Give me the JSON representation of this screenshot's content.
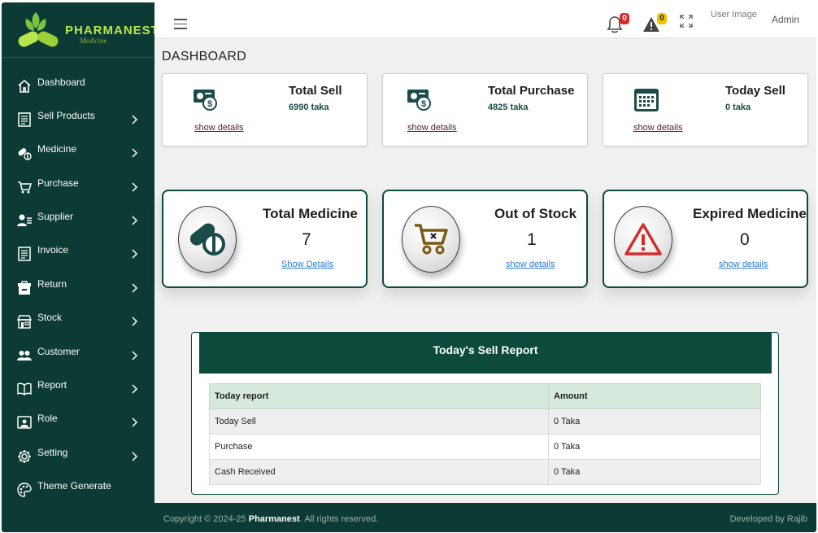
{
  "brand": {
    "name": "PHARMANEST",
    "tagline": "Medicine"
  },
  "sidebar": {
    "items": [
      {
        "label": "Dashboard",
        "icon": "home-icon",
        "has_children": false
      },
      {
        "label": "Sell Products",
        "icon": "receipt-icon",
        "has_children": true
      },
      {
        "label": "Medicine",
        "icon": "pill-icon",
        "has_children": true
      },
      {
        "label": "Purchase",
        "icon": "cart-icon",
        "has_children": true
      },
      {
        "label": "Supplier",
        "icon": "supplier-icon",
        "has_children": true
      },
      {
        "label": "Invoice",
        "icon": "invoice-icon",
        "has_children": true
      },
      {
        "label": "Return",
        "icon": "return-box-icon",
        "has_children": true
      },
      {
        "label": "Stock",
        "icon": "store-icon",
        "has_children": true
      },
      {
        "label": "Customer",
        "icon": "users-icon",
        "has_children": true
      },
      {
        "label": "Report",
        "icon": "book-icon",
        "has_children": true
      },
      {
        "label": "Role",
        "icon": "id-badge-icon",
        "has_children": true
      },
      {
        "label": "Setting",
        "icon": "gear-icon",
        "has_children": true
      },
      {
        "label": "Theme Generate",
        "icon": "palette-icon",
        "has_children": false
      }
    ]
  },
  "topbar": {
    "notifications_count": "0",
    "alerts_count": "0",
    "user_image_alt": "User Image",
    "user_name": "Admin"
  },
  "page_title": "DASHBOARD",
  "summary_cards": [
    {
      "title": "Total Sell",
      "value": "6990 taka",
      "link": "show details",
      "icon": "money-icon"
    },
    {
      "title": "Total Purchase",
      "value": "4825 taka",
      "link": "show details",
      "icon": "money-icon"
    },
    {
      "title": "Today Sell",
      "value": "0 taka",
      "link": "show details",
      "icon": "calendar-icon"
    }
  ],
  "stat_cards": [
    {
      "title": "Total Medicine",
      "value": "7",
      "link": "Show Details",
      "icon": "pill-icon"
    },
    {
      "title": "Out of Stock",
      "value": "1",
      "link": "show details",
      "icon": "cart-x-icon"
    },
    {
      "title": "Expired Medicine",
      "value": "0",
      "link": "show details",
      "icon": "warning-triangle-icon"
    }
  ],
  "report": {
    "title": "Today's Sell Report",
    "columns": [
      "Today report",
      "Amount"
    ],
    "rows": [
      [
        "Today Sell",
        "0 Taka"
      ],
      [
        "Purchase",
        "0 Taka"
      ],
      [
        "Cash Received",
        "0 Taka"
      ]
    ]
  },
  "footer": {
    "copyright_prefix": "Copyright © 2024-25",
    "brand": "Pharmanest",
    "rights": ". All rights reserved.",
    "developer": "Developed by Rajib"
  },
  "colors": {
    "sidebar": "#0c3a34",
    "accent": "#0c4a3c",
    "badge_red": "#d62c2c",
    "badge_yellow": "#f2c200",
    "link_blue": "#2a7ad8"
  }
}
